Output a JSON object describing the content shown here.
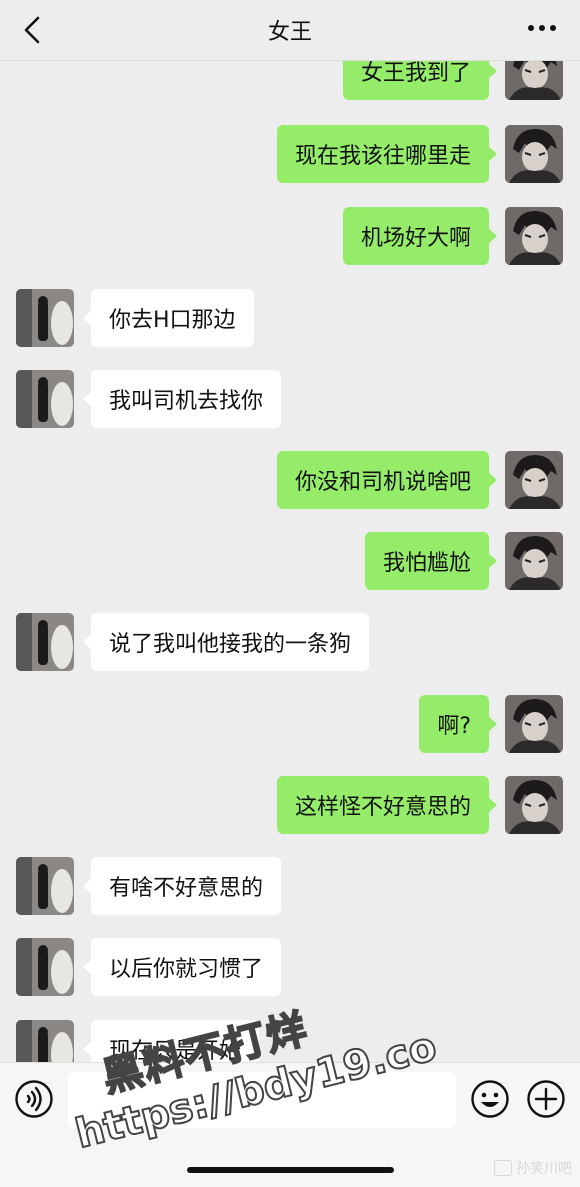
{
  "header": {
    "title": "女王"
  },
  "messages": [
    {
      "side": "right",
      "text": "女王我到了"
    },
    {
      "side": "right",
      "text": "现在我该往哪里走"
    },
    {
      "side": "right",
      "text": "机场好大啊"
    },
    {
      "side": "left",
      "text": "你去H口那边"
    },
    {
      "side": "left",
      "text": "我叫司机去找你"
    },
    {
      "side": "right",
      "text": "你没和司机说啥吧"
    },
    {
      "side": "right",
      "text": "我怕尴尬"
    },
    {
      "side": "left",
      "text": "说了我叫他接我的一条狗"
    },
    {
      "side": "right",
      "text": "啊?"
    },
    {
      "side": "right",
      "text": "这样怪不好意思的"
    },
    {
      "side": "left",
      "text": "有啥不好意思的"
    },
    {
      "side": "left",
      "text": "以后你就习惯了"
    },
    {
      "side": "left",
      "text": "现在只是开始"
    }
  ],
  "input": {
    "value": ""
  },
  "icons": {
    "back": "chevron-left-icon",
    "more": "more-icon",
    "voice": "voice-icon",
    "emoji": "emoji-icon",
    "plus": "plus-icon"
  },
  "colors": {
    "background": "#ededed",
    "bubble_self": "#95ec69",
    "bubble_other": "#ffffff"
  },
  "watermark": {
    "line1": "黑料不打烊",
    "line2": "https://bdy19.co",
    "corner": "孙笑川吧"
  }
}
